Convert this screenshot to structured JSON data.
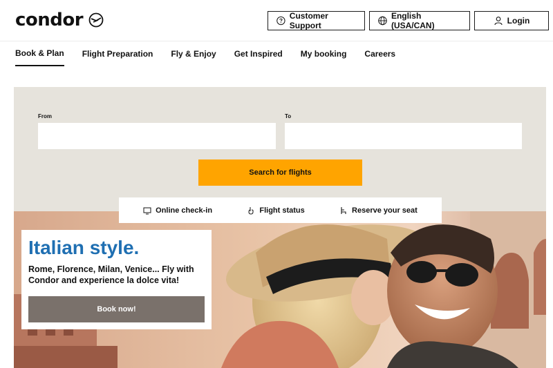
{
  "brand": {
    "name": "condor",
    "mark_icon": "condor-logo-icon"
  },
  "header": {
    "support_label": "Customer Support",
    "language_label": "English (USA/CAN)",
    "login_label": "Login"
  },
  "nav": {
    "items": [
      {
        "label": "Book & Plan"
      },
      {
        "label": "Flight Preparation"
      },
      {
        "label": "Fly & Enjoy"
      },
      {
        "label": "Get Inspired"
      },
      {
        "label": "My booking"
      },
      {
        "label": "Careers"
      }
    ]
  },
  "search": {
    "from_label": "From",
    "to_label": "To",
    "from_value": "",
    "to_value": "",
    "button_label": "Search for flights"
  },
  "quick_links": [
    {
      "label": "Online check-in",
      "icon": "monitor-icon"
    },
    {
      "label": "Flight status",
      "icon": "hand-pointer-icon"
    },
    {
      "label": "Reserve your seat",
      "icon": "seat-icon"
    }
  ],
  "promo": {
    "title": "Italian style.",
    "text": "Rome, Florence, Milan, Venice... Fly with Condor and experience la dolce vita!",
    "button_label": "Book now!"
  },
  "colors": {
    "accent": "#ffa400",
    "title_blue": "#1f6fb2",
    "panel_bg": "#e6e3dc",
    "promo_button": "#7a716b"
  }
}
